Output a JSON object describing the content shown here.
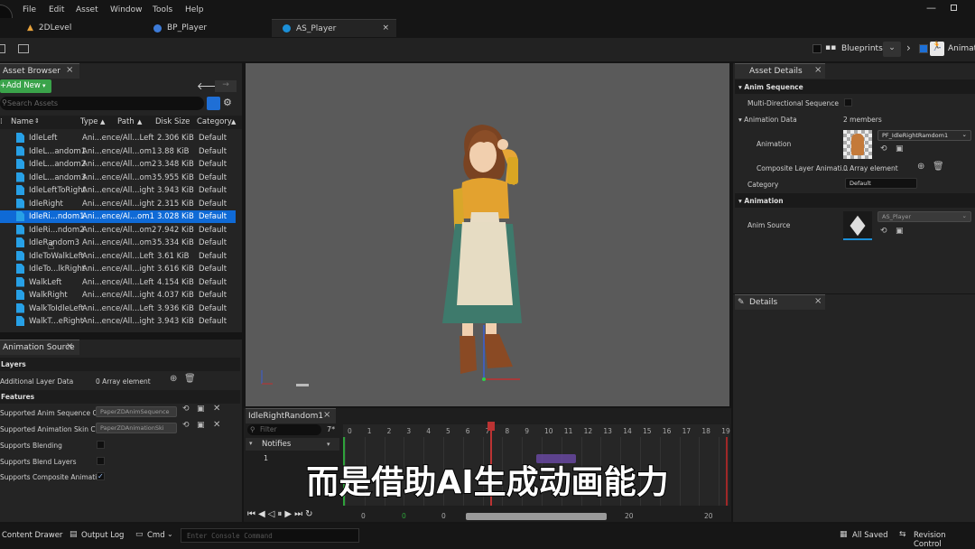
{
  "menu": [
    "File",
    "Edit",
    "Asset",
    "Window",
    "Tools",
    "Help"
  ],
  "tabs": [
    {
      "label": "2DLevel",
      "active": false
    },
    {
      "label": "BP_Player",
      "active": false
    },
    {
      "label": "AS_Player",
      "active": true
    }
  ],
  "toolbar": {
    "blueprints_label": "Blueprints",
    "animation_label": "Animati"
  },
  "asset_browser": {
    "tab": "Asset Browser",
    "add_new": "Add New",
    "search_placeholder": "Search Assets",
    "columns": [
      "Name",
      "Type",
      "Path",
      "Disk Size",
      "Category"
    ],
    "rows": [
      {
        "name": "IdleLeft",
        "type": "Ani...ence",
        "path": "/All...Left",
        "size": "2.306 KiB",
        "category": "Default"
      },
      {
        "name": "IdleL...andom1",
        "type": "Ani...ence",
        "path": "/All...om1",
        "size": "3.88 KiB",
        "category": "Default"
      },
      {
        "name": "IdleL...andom2",
        "type": "Ani...ence",
        "path": "/All...om2",
        "size": "3.348 KiB",
        "category": "Default"
      },
      {
        "name": "IdleL...andom3",
        "type": "Ani...ence",
        "path": "/All...om3",
        "size": "5.955 KiB",
        "category": "Default"
      },
      {
        "name": "IdleLeftToRight",
        "type": "Ani...ence",
        "path": "/All...ight",
        "size": "3.943 KiB",
        "category": "Default"
      },
      {
        "name": "IdleRight",
        "type": "Ani...ence",
        "path": "/All...ight",
        "size": "2.315 KiB",
        "category": "Default"
      },
      {
        "name": "IdleRi...ndom1",
        "type": "Ani...ence",
        "path": "/Al...om1",
        "size": "3.028 KiB",
        "category": "Default",
        "selected": true
      },
      {
        "name": "IdleRi...ndom2",
        "type": "Ani...ence",
        "path": "/All...om2",
        "size": "7.942 KiB",
        "category": "Default"
      },
      {
        "name": "IdleRandom3",
        "type": "Ani...ence",
        "path": "/All...om3",
        "size": "5.334 KiB",
        "category": "Default"
      },
      {
        "name": "IdleToWalkLeft",
        "type": "Ani...ence",
        "path": "/All...Left",
        "size": "3.61 KiB",
        "category": "Default"
      },
      {
        "name": "IdleTo...lkRight",
        "type": "Ani...ence",
        "path": "/All...ight",
        "size": "3.616 KiB",
        "category": "Default"
      },
      {
        "name": "WalkLeft",
        "type": "Ani...ence",
        "path": "/All...Left",
        "size": "4.154 KiB",
        "category": "Default"
      },
      {
        "name": "WalkRight",
        "type": "Ani...ence",
        "path": "/All...ight",
        "size": "4.037 KiB",
        "category": "Default"
      },
      {
        "name": "WalkToIdleLeft",
        "type": "Ani...ence",
        "path": "/All...Left",
        "size": "3.936 KiB",
        "category": "Default"
      },
      {
        "name": "WalkT...eRight",
        "type": "Ani...ence",
        "path": "/All...ight",
        "size": "3.943 KiB",
        "category": "Default"
      }
    ]
  },
  "animation_source": {
    "tab": "Animation Source",
    "layers_header": "Layers",
    "additional_layer_label": "Additional Layer Data",
    "additional_layer_value": "0 Array element",
    "features_header": "Features",
    "anim_seq_label": "Supported Anim Sequence Cl...",
    "anim_seq_value": "PaperZDAnimSequence",
    "anim_skin_label": "Supported Animation Skin Cl...",
    "anim_skin_value": "PaperZDAnimationSki",
    "blending_label": "Supports Blending",
    "blend_layers_label": "Supports Blend Layers",
    "composite_label": "Supports Composite Animati..."
  },
  "timeline": {
    "tab": "IdleRightRandom1",
    "filter_placeholder": "Filter",
    "filter_count": "7*",
    "notifies_label": "Notifies",
    "track_number": "1",
    "ticks": [
      "0",
      "1",
      "2",
      "3",
      "4",
      "5",
      "6",
      "7*",
      "8",
      "9",
      "10",
      "11",
      "12",
      "13",
      "14",
      "15",
      "16",
      "17",
      "18",
      "19"
    ],
    "playhead_label": "7*",
    "range_values": [
      "0",
      "0",
      "0",
      "20",
      "20"
    ]
  },
  "asset_details": {
    "tab": "Asset Details",
    "anim_sequence_header": "Anim Sequence",
    "multi_dir_label": "Multi-Directional Sequence",
    "animation_data_label": "Animation Data",
    "animation_data_value": "2 members",
    "animation_label": "Animation",
    "animation_value": "PF_IdleRightRamdom1",
    "composite_label": "Composite Layer Animati...",
    "composite_value": "0 Array element",
    "category_label": "Category",
    "category_value": "Default",
    "animation_header": "Animation",
    "anim_source_label": "Anim Source",
    "anim_source_value": "AS_Player"
  },
  "details": {
    "tab": "Details"
  },
  "statusbar": {
    "content_drawer": "Content Drawer",
    "output_log": "Output Log",
    "cmd": "Cmd",
    "console_placeholder": "Enter Console Command",
    "all_saved": "All Saved",
    "revision_control": "Revision Control"
  },
  "subtitle": "而是借助AI生成动画能力",
  "colors": {
    "accent": "#0f6ad6",
    "add_new": "#3aa34a",
    "asset_icon": "#27a0e6",
    "viewport": "#5a5a5a"
  }
}
